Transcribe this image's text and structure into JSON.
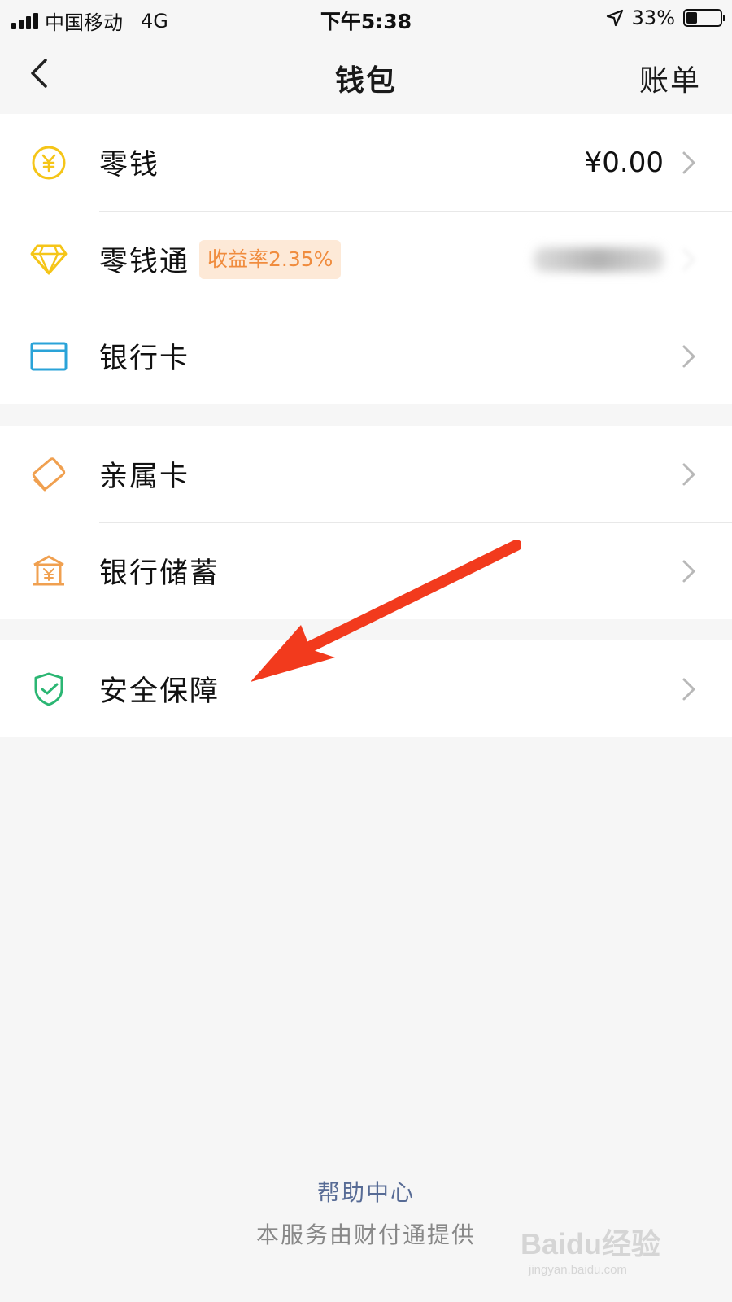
{
  "status_bar": {
    "carrier": "中国移动",
    "network": "4G",
    "time": "下午5:38",
    "battery_text": "33%",
    "battery_level": 0.33
  },
  "nav": {
    "title": "钱包",
    "right_action": "账单"
  },
  "groups": [
    {
      "items": [
        {
          "label": "零钱",
          "value": "¥0.00",
          "icon": "yuan-coin-icon"
        },
        {
          "label": "零钱通",
          "badge": "收益率2.35%",
          "value_blurred": true,
          "icon": "diamond-icon"
        },
        {
          "label": "银行卡",
          "icon": "bank-card-icon"
        }
      ]
    },
    {
      "items": [
        {
          "label": "亲属卡",
          "icon": "family-card-icon"
        },
        {
          "label": "银行储蓄",
          "icon": "bank-savings-icon"
        }
      ]
    },
    {
      "items": [
        {
          "label": "安全保障",
          "icon": "shield-check-icon"
        }
      ]
    }
  ],
  "footer": {
    "help_link": "帮助中心",
    "provider_text": "本服务由财付通提供"
  },
  "watermark": {
    "brand": "Baidu经验",
    "url": "jingyan.baidu.com"
  },
  "colors": {
    "yuan_icon": "#f5c518",
    "diamond_icon": "#f5c518",
    "bank_card_icon": "#2aa3d8",
    "family_card_icon": "#f0a050",
    "savings_icon": "#f0a050",
    "shield_icon": "#2bb673",
    "badge_bg": "#fde9d7",
    "badge_text": "#f08c3e",
    "help_link": "#576b95",
    "annotation_arrow": "#f23a1d"
  }
}
